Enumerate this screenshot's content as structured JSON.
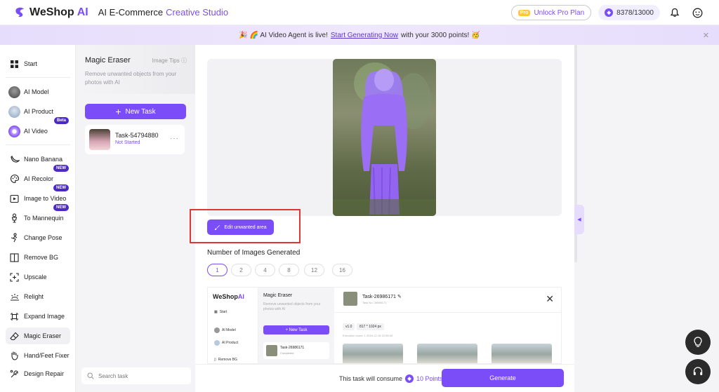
{
  "header": {
    "logo_text": "WeShop",
    "logo_ai": "AI",
    "title": "AI E-Commerce",
    "title_accent": "Creative Studio",
    "pro_tag": "Pro",
    "unlock_label": "Unlock Pro Plan",
    "points": "8378/13000"
  },
  "banner": {
    "text_before": "🎉 🌈 AI Video Agent is live!",
    "link": "Start Generating Now",
    "text_after": "with your 3000 points! 🥳"
  },
  "nav": {
    "start": "Start",
    "ai_model": "AI Model",
    "ai_product": "AI Product",
    "ai_video": "AI Video",
    "beta_badge": "Beta",
    "nano_banana": "Nano Banana",
    "ai_recolor": "AI Recolor",
    "image_to_video": "Image to Video",
    "to_mannequin": "To Mannequin",
    "change_pose": "Change Pose",
    "remove_bg": "Remove BG",
    "upscale": "Upscale",
    "relight": "Relight",
    "expand_image": "Expand Image",
    "magic_eraser": "Magic Eraser",
    "hand_feet_fixer": "Hand/Feet Fixer",
    "design_repair": "Design Repair",
    "new_badge": "NEW"
  },
  "panel": {
    "title": "Magic Eraser",
    "tips": "Image Tips",
    "description": "Remove unwanted objects from your photos with AI",
    "new_task": "New Task",
    "task_name": "Task-54794880",
    "task_status": "Not Started",
    "search_placeholder": "Search task"
  },
  "main": {
    "edit_button": "Edit unwanted area",
    "num_label": "Number of Images Generated",
    "num_options": [
      "1",
      "2",
      "4",
      "8",
      "12",
      "16"
    ],
    "selected_option": "1"
  },
  "example": {
    "logo_text": "WeShop",
    "logo_ai": "AI",
    "start": "Start",
    "ai_model": "AI Model",
    "ai_product": "AI Product",
    "remove_bg": "Remove BG",
    "title": "Magic Eraser",
    "description": "Remove unwanted objects from your photos with AI",
    "new_task": "+ New Task",
    "task_name": "Task-26986171",
    "task_status": "Completed",
    "header_task": "Task-26986171",
    "task_no": "Task No. 26986171",
    "version": "v1.0",
    "size": "817 * 1024 px",
    "execution": "Execution count: 1     2024-12-18 22:55:49"
  },
  "footer": {
    "consume_text": "This task will consume",
    "points": "10 Points",
    "generate": "Generate"
  },
  "colors": {
    "accent": "#7b4df8",
    "highlight_box": "#e23636"
  }
}
